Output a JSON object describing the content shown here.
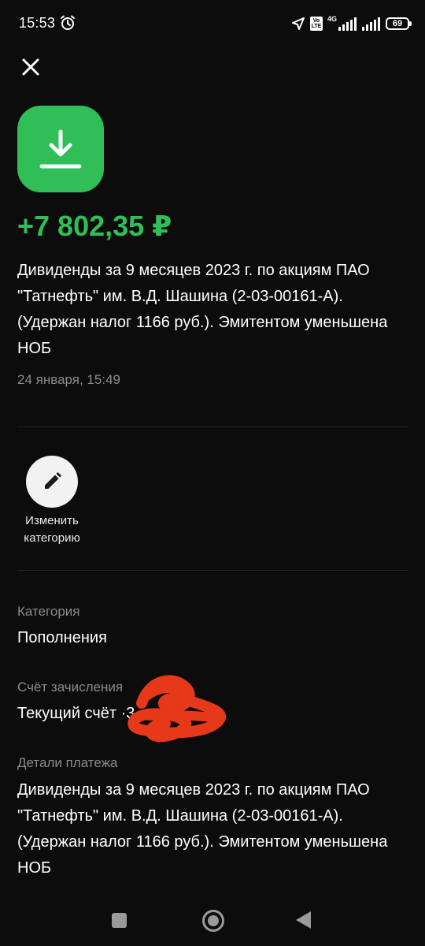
{
  "status_bar": {
    "time": "15:53",
    "network": "4G",
    "volte": "Vo LTE",
    "battery": "69"
  },
  "transaction": {
    "amount": "+7 802,35 ₽",
    "description": "Дивиденды за 9 месяцев 2023 г. по акциям ПАО \"Татнефть\" им. В.Д. Шашина (2-03-00161-А). (Удержан налог 1166 руб.). Эмитентом уменьшена НОБ",
    "datetime": "24 января, 15:49",
    "amount_color": "#2fbf56",
    "icon": "download-icon"
  },
  "actions": {
    "edit_category_label": "Изменить категорию"
  },
  "fields": {
    "category_label": "Категория",
    "category_value": "Пополнения",
    "account_label": "Счёт зачисления",
    "account_value": "Текущий счёт ·3",
    "details_label": "Детали платежа",
    "details_value": "Дивиденды за 9 месяцев 2023 г. по акциям ПАО \"Татнефть\" им. В.Д. Шашина (2-03-00161-А). (Удержан налог 1166 руб.). Эмитентом уменьшена НОБ"
  },
  "colors": {
    "background": "#0c0c0c",
    "accent_green": "#2fbf56",
    "muted_text": "#8b8b8b",
    "redaction": "#e8381a"
  }
}
